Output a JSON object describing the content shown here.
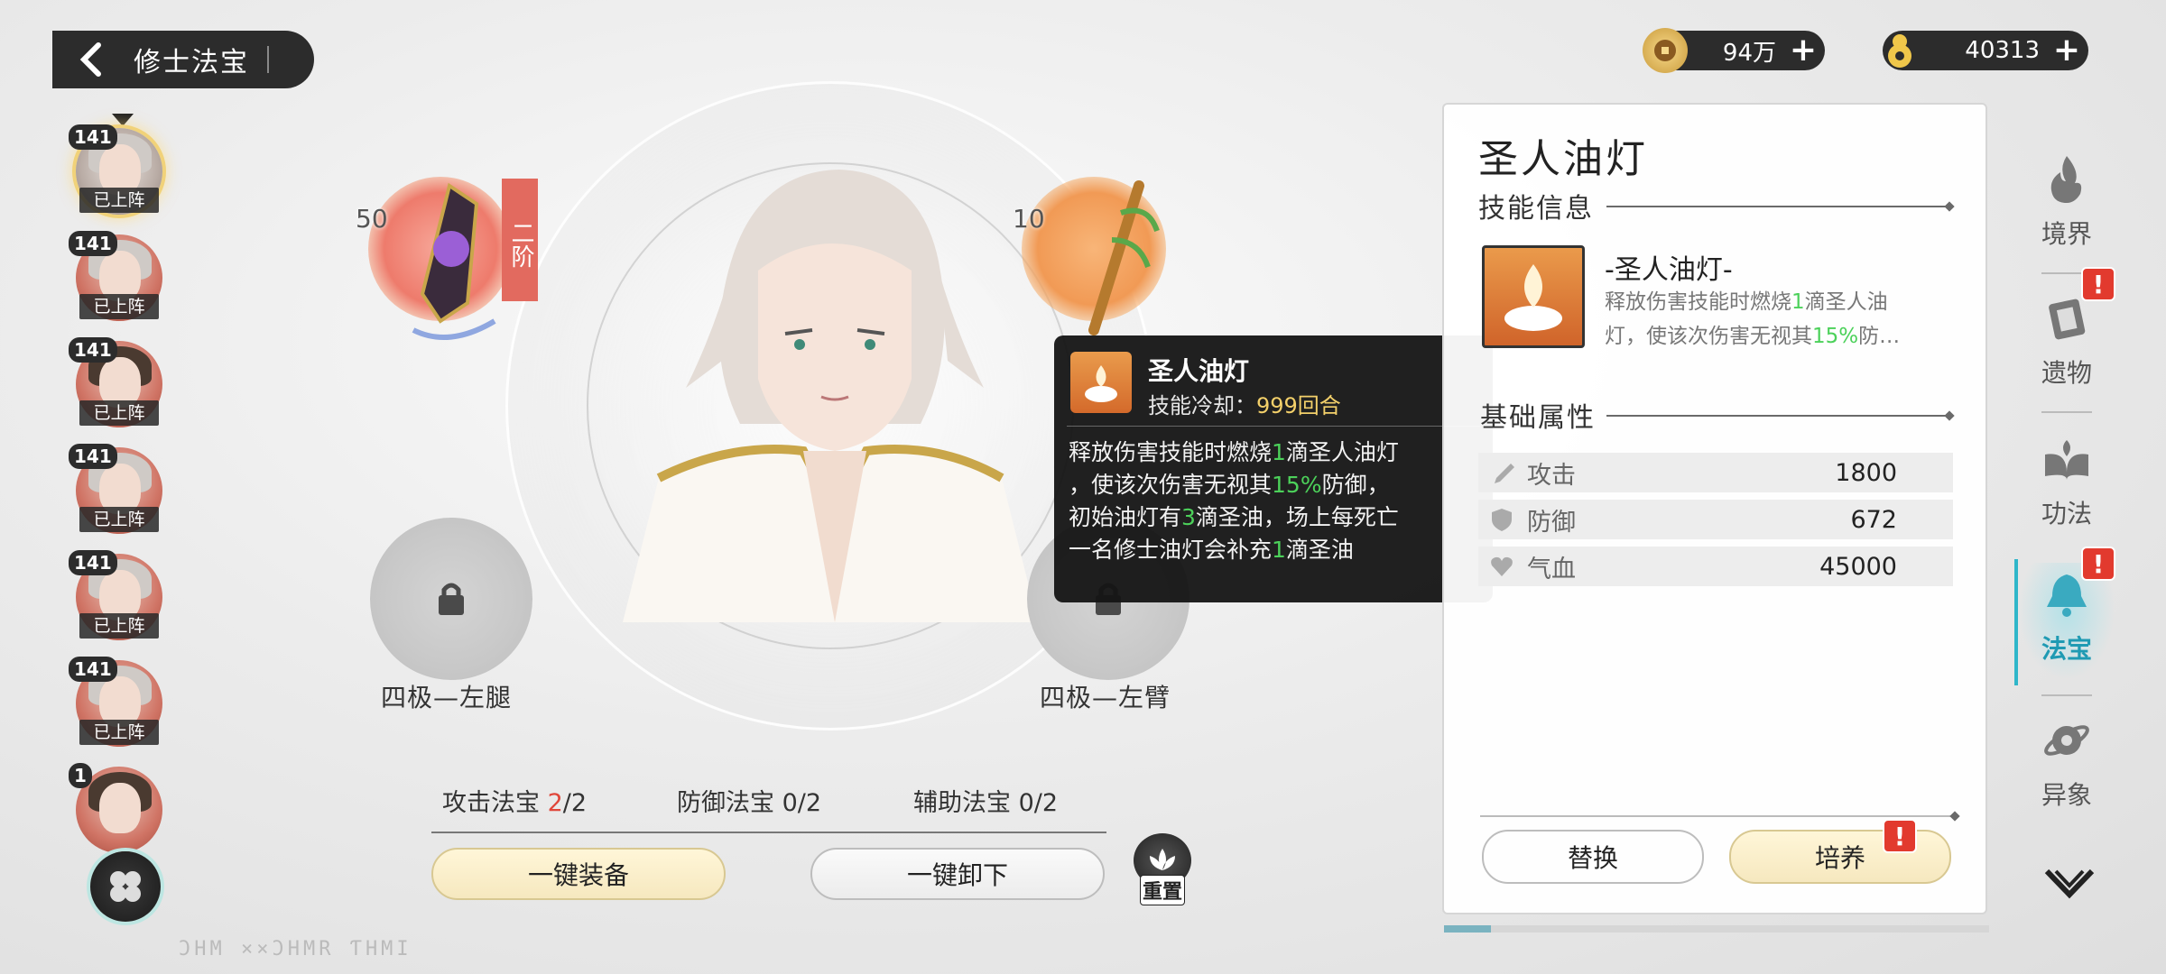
{
  "header": {
    "title": "修士法宝",
    "back_icon": "chevron-left-icon"
  },
  "currencies": [
    {
      "name": "coin",
      "icon": "coin-icon",
      "value": "94万"
    },
    {
      "name": "spirit",
      "icon": "spirit-gourd-icon",
      "value": "40313"
    }
  ],
  "roster": [
    {
      "level": "141",
      "status": "已上阵",
      "selected": true
    },
    {
      "level": "141",
      "status": "已上阵"
    },
    {
      "level": "141",
      "status": "已上阵"
    },
    {
      "level": "141",
      "status": "已上阵"
    },
    {
      "level": "141",
      "status": "已上阵"
    },
    {
      "level": "141",
      "status": "已上阵"
    },
    {
      "level": "1",
      "status": ""
    }
  ],
  "slots": {
    "top_left": {
      "level": "50",
      "grade": "二阶",
      "color": "#e3553f"
    },
    "top_right": {
      "level": "10",
      "color": "#ef9a52"
    },
    "bottom_left": {
      "label": "四极—左腿",
      "locked": true
    },
    "bottom_right": {
      "label": "四极—左臂",
      "locked": true
    }
  },
  "tooltip": {
    "name": "圣人油灯",
    "cooldown_label": "技能冷却：",
    "cooldown_value": "999回合",
    "desc": [
      [
        "释放伤害技能时燃烧",
        "1",
        "滴圣人油灯"
      ],
      [
        "，使该次伤害无视其",
        "15%",
        "防御，"
      ],
      [
        "初始油灯有",
        "3",
        "滴圣油，场上每死亡"
      ],
      [
        "一名修士油灯会补充",
        "1",
        "滴圣油"
      ]
    ]
  },
  "counts": {
    "attack": {
      "label": "攻击法宝",
      "cur": "2",
      "max": "/2"
    },
    "defense": {
      "label": "防御法宝",
      "value": "0/2"
    },
    "support": {
      "label": "辅助法宝",
      "value": "0/2"
    }
  },
  "buttons": {
    "equip_all": "一键装备",
    "unequip_all": "一键卸下",
    "reset": "重置"
  },
  "footer_deco": "ƆHM  ××ƆHMR ƬHMI",
  "panel": {
    "title": "圣人油灯",
    "skill_section": "技能信息",
    "skill_name": "-圣人油灯-",
    "skill_desc_a": "释放伤害技能时燃烧",
    "skill_desc_b": "1",
    "skill_desc_c": "滴圣人油",
    "skill_desc_d": "灯，使该次伤害无视其",
    "skill_desc_e": "15%",
    "skill_desc_f": "防…",
    "attr_section": "基础属性",
    "stats": [
      {
        "icon": "sword-icon",
        "label": "攻击",
        "value": "1800"
      },
      {
        "icon": "shield-icon",
        "label": "防御",
        "value": "672"
      },
      {
        "icon": "heart-icon",
        "label": "气血",
        "value": "45000"
      }
    ],
    "replace": "替换",
    "train": "培养"
  },
  "nav": [
    {
      "label": "境界",
      "icon": "realm-flame-icon",
      "alert": false
    },
    {
      "label": "遗物",
      "icon": "relic-icon",
      "alert": true
    },
    {
      "label": "功法",
      "icon": "technique-book-icon",
      "alert": false
    },
    {
      "label": "法宝",
      "icon": "treasure-bell-icon",
      "alert": true,
      "active": true
    },
    {
      "label": "异象",
      "icon": "anomaly-orb-icon",
      "alert": false
    }
  ],
  "colors": {
    "accent": "#2fb6c9",
    "alert": "#e23a2e",
    "highlight_green": "#4cd15a",
    "cooldown": "#f3d06a"
  }
}
